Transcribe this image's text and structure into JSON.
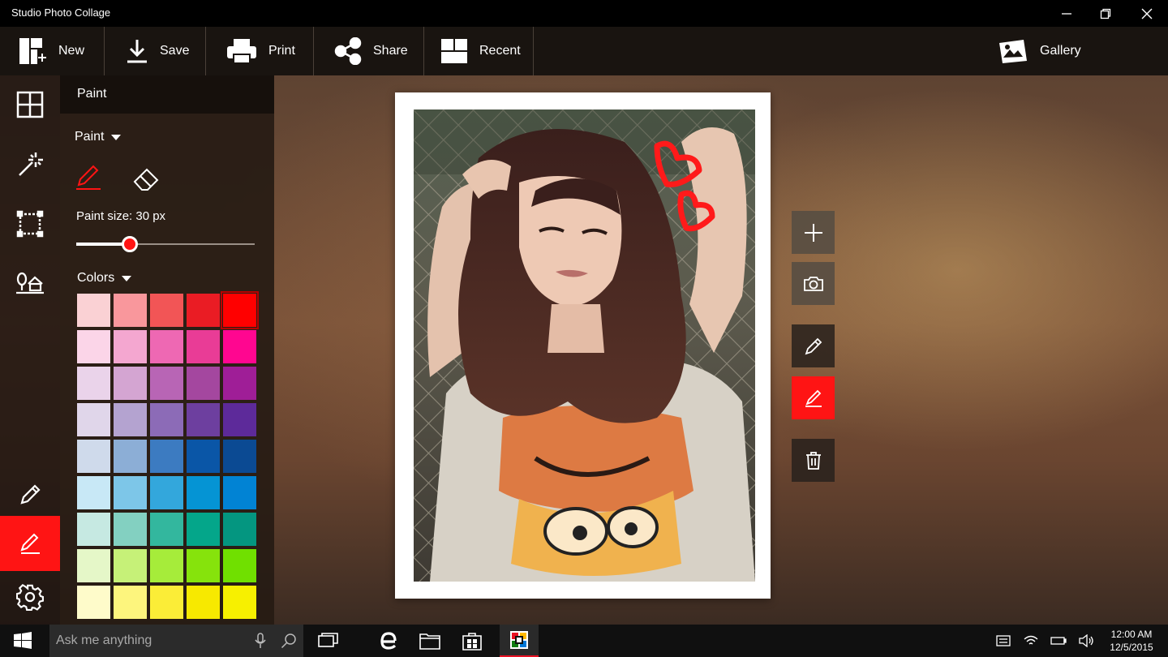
{
  "app": {
    "title": "Studio Photo Collage",
    "window_controls": [
      "minimize-icon",
      "restore-icon",
      "close-icon"
    ]
  },
  "toolbar": {
    "new_label": "New",
    "save_label": "Save",
    "print_label": "Print",
    "share_label": "Share",
    "recent_label": "Recent",
    "gallery_label": "Gallery"
  },
  "left_rail": {
    "items": [
      "layout-grid-icon",
      "magic-wand-icon",
      "frame-icon",
      "scene-icon",
      "pencil-icon",
      "paint-pen-icon",
      "settings-gear-icon"
    ],
    "active": "paint-pen-icon"
  },
  "panel": {
    "header": "Paint",
    "mode_dropdown": "Paint",
    "tools": [
      "pen-icon",
      "eraser-icon"
    ],
    "paint_size_label": "Paint size: 30 px",
    "paint_size_value": 30,
    "slider_fraction": 0.3,
    "colors_dropdown": "Colors",
    "selected_color": "#ff0000",
    "colors": [
      [
        "#fad1d4",
        "#f9979c",
        "#f25556",
        "#ea1c24",
        "#ff0000"
      ],
      [
        "#fbd5e8",
        "#f4a7d0",
        "#ee68b3",
        "#e93c96",
        "#ff0690"
      ],
      [
        "#ead3ea",
        "#d4a5d2",
        "#b865b5",
        "#a4479f",
        "#9f1e97"
      ],
      [
        "#e0d6ea",
        "#b4a3d0",
        "#8c6bb7",
        "#6d3f9f",
        "#5d2a9a"
      ],
      [
        "#cfdaeb",
        "#8caed6",
        "#3c7bc1",
        "#0a56a7",
        "#0b4a93"
      ],
      [
        "#c8e8f6",
        "#7dc6e8",
        "#33a7dc",
        "#0594d4",
        "#0183d4"
      ],
      [
        "#c6e9e2",
        "#83d0c1",
        "#33b79e",
        "#04a68a",
        "#049680"
      ],
      [
        "#e5f7c8",
        "#c6f178",
        "#a6ec3a",
        "#86e30c",
        "#70e000"
      ],
      [
        "#fefbca",
        "#fdf57d",
        "#fbed37",
        "#f7e900",
        "#f7f000"
      ]
    ]
  },
  "canvas": {
    "side_buttons": [
      "add-icon",
      "camera-icon",
      "pencil-icon",
      "paint-pen-icon",
      "trash-icon"
    ],
    "active_side_button": "paint-pen-icon"
  },
  "taskbar": {
    "search_placeholder": "Ask me anything",
    "time": "12:00 AM",
    "date": "12/5/2015",
    "pinned": [
      "task-view-icon",
      "edge-icon",
      "file-explorer-icon",
      "store-icon",
      "photo-collage-app-icon"
    ],
    "tray": [
      "action-center-icon",
      "wifi-icon",
      "battery-icon",
      "volume-icon"
    ]
  }
}
